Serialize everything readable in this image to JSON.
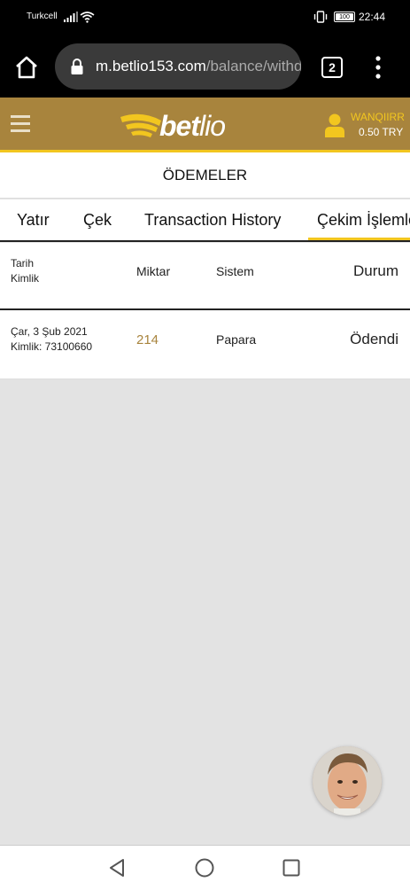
{
  "status_bar": {
    "carrier": "Turkcell",
    "battery": "100",
    "time": "22:44"
  },
  "browser": {
    "url_domain": "m.betlio153.com",
    "url_path": "/balance/withdr",
    "tab_count": "2"
  },
  "header": {
    "logo_text_bet": "bet",
    "logo_text_lio": "lio",
    "username": "WANQIIRR",
    "balance": "0.50 TRY"
  },
  "page": {
    "title": "ÖDEMELER"
  },
  "tabs": [
    {
      "label": "Yatır",
      "active": false
    },
    {
      "label": "Çek",
      "active": false
    },
    {
      "label": "Transaction History",
      "active": false
    },
    {
      "label": "Çekim İşlemle",
      "active": true
    }
  ],
  "table": {
    "headers": {
      "date": "Tarih",
      "id": "Kimlik",
      "amount": "Miktar",
      "system": "Sistem",
      "status": "Durum"
    },
    "rows": [
      {
        "date": "Çar, 3 Şub 2021",
        "id": "Kimlik: 73100660",
        "amount": "214",
        "system": "Papara",
        "status": "Ödendi"
      }
    ]
  },
  "colors": {
    "header_bg": "#a8843d",
    "accent": "#f2c61f",
    "amount": "#a8843d"
  }
}
